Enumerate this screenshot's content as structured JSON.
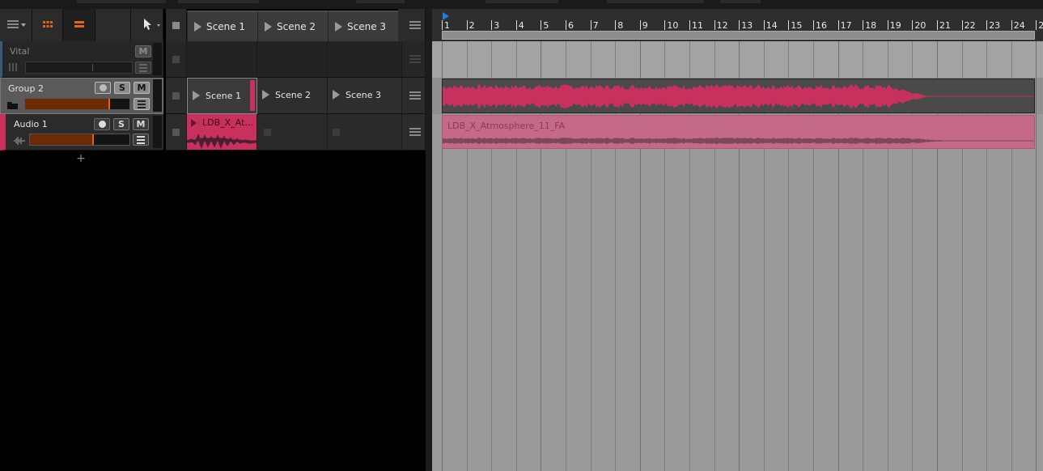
{
  "scenes": [
    "Scene 1",
    "Scene 2",
    "Scene 3"
  ],
  "tracks": [
    {
      "name": "Vital",
      "mute_label": "M"
    },
    {
      "name": "Group 2",
      "solo_label": "S",
      "mute_label": "M"
    },
    {
      "name": "Audio 1",
      "solo_label": "S",
      "mute_label": "M"
    }
  ],
  "group_scene_labels": [
    "Scene 1",
    "Scene 2",
    "Scene 3"
  ],
  "clip_launcher_clip": "LDB_X_At...",
  "arranger_clip_name": "LDB_X_Atmosphere_11_FA",
  "add_track_label": "+",
  "ruler_numbers": [
    "1",
    "2",
    "3",
    "4",
    "5",
    "6",
    "7",
    "8",
    "9",
    "10",
    "11",
    "12",
    "13",
    "14",
    "15",
    "16",
    "17",
    "18",
    "19",
    "20",
    "21",
    "22",
    "23",
    "24",
    "2"
  ],
  "colors": {
    "accent_pink": "#c8305e",
    "meter_orange": "#e56018",
    "playhead_blue": "#1e7fd9"
  }
}
